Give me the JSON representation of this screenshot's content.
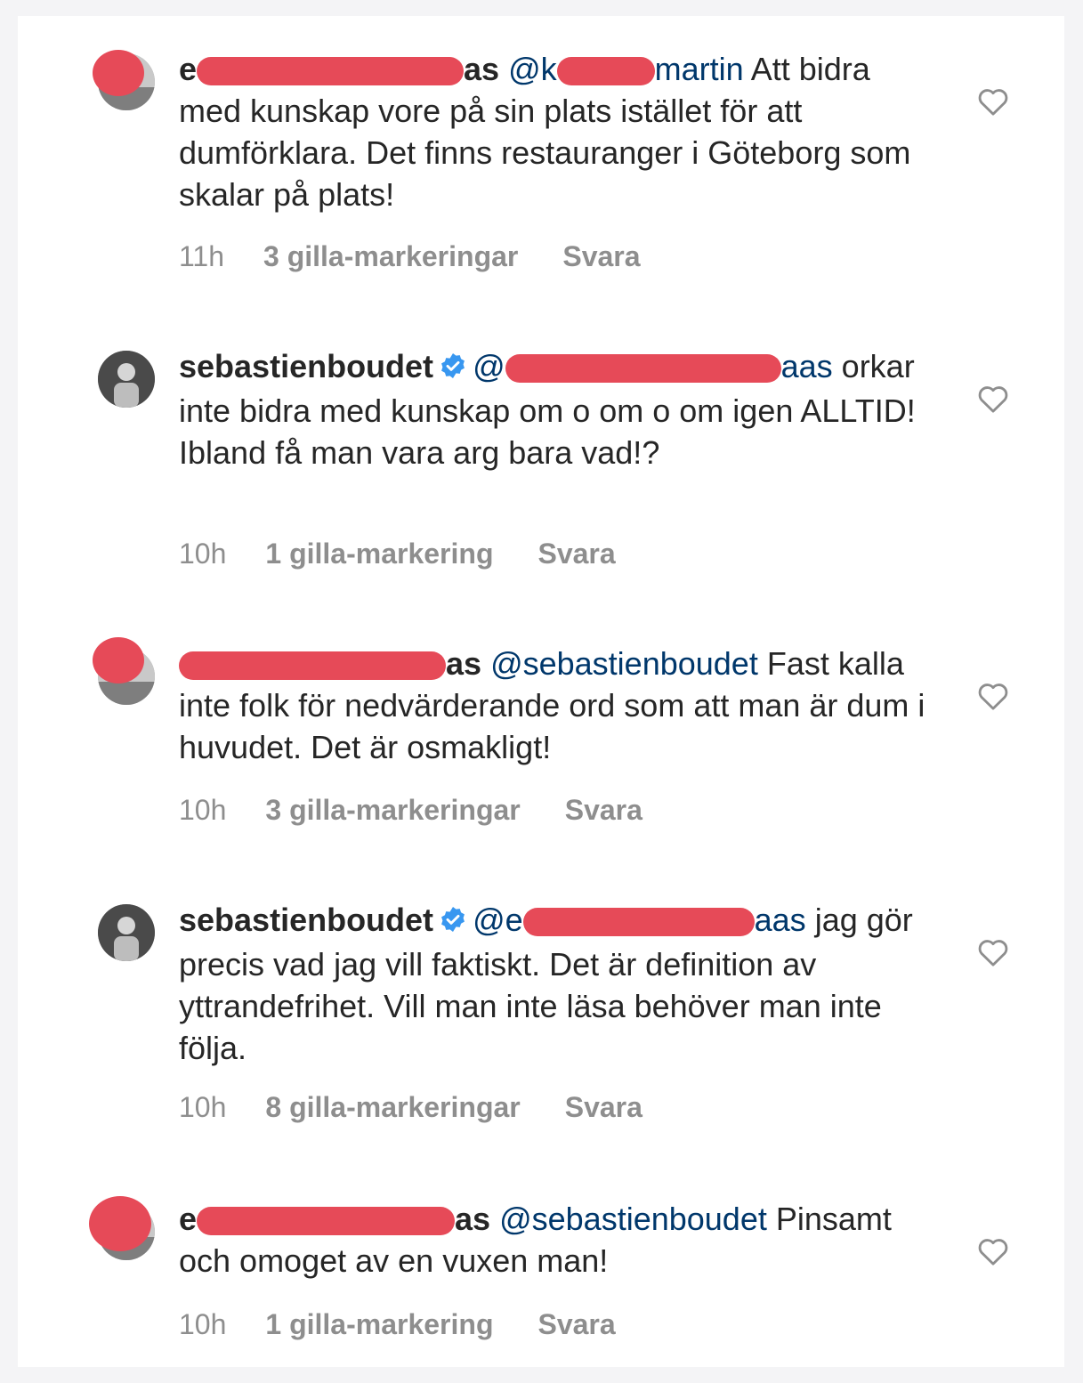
{
  "comments": [
    {
      "username_prefix": "e",
      "username_suffix": "as",
      "verified": false,
      "mention_prefix": "@k",
      "mention_suffix": "martin",
      "text_lead": " Att bidra",
      "text_rest": "med kunskap vore på sin plats istället för att dumförklara. Det finns restauranger i Göteborg som skalar på plats!",
      "time": "11h",
      "likes": "3 gilla-markeringar",
      "reply": "Svara"
    },
    {
      "username": "sebastienboudet",
      "verified": true,
      "mention_prefix": "@",
      "mention_suffix": "aas",
      "text_rest": "orkar inte bidra med kunskap om o om o om igen ALLTID! Ibland få man vara arg bara vad!?",
      "time": "10h",
      "likes": "1 gilla-markering",
      "reply": "Svara"
    },
    {
      "username_prefix": "",
      "username_suffix": "as",
      "verified": false,
      "mention": "@sebastienboudet",
      "text_lead": " Fast",
      "text_rest": "kalla inte folk för nedvärderande ord som att man är dum i huvudet. Det är osmakligt!",
      "time": "10h",
      "likes": "3 gilla-markeringar",
      "reply": "Svara"
    },
    {
      "username": "sebastienboudet",
      "verified": true,
      "mention_prefix": "@e",
      "mention_suffix": "aas",
      "text_lead": " jag",
      "text_rest": "gör precis vad jag vill faktiskt. Det är definition av yttrandefrihet. Vill man inte läsa behöver man inte följa.",
      "time": "10h",
      "likes": "8 gilla-markeringar",
      "reply": "Svara"
    },
    {
      "username_prefix": "e",
      "username_suffix": "as",
      "verified": false,
      "mention": "@sebastienboudet",
      "text_rest": "Pinsamt och omoget av en vuxen man!",
      "time": "10h",
      "likes": "1 gilla-markering",
      "reply": "Svara"
    }
  ],
  "colors": {
    "mention": "#00376b",
    "meta": "#8e8e8e",
    "verified": "#3897f0",
    "redaction": "#e64a58"
  },
  "icons": {
    "like": "heart-outline-icon",
    "verified": "verified-badge-icon"
  }
}
